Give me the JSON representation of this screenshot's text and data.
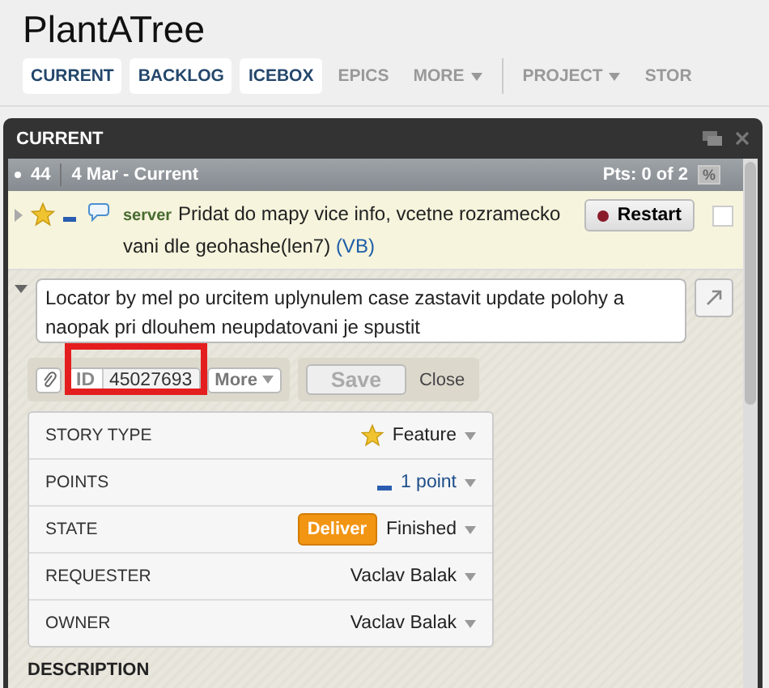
{
  "project": {
    "title": "PlantATree"
  },
  "nav": {
    "panels": [
      {
        "label": "CURRENT",
        "selected": true
      },
      {
        "label": "BACKLOG",
        "selected": true
      },
      {
        "label": "ICEBOX",
        "selected": true
      },
      {
        "label": "EPICS",
        "selected": false
      }
    ],
    "more_menu": {
      "label": "MORE"
    },
    "project_menus": [
      {
        "label": "PROJECT"
      },
      {
        "label": "STOR"
      }
    ]
  },
  "panel": {
    "title": "CURRENT",
    "iteration": {
      "number": "44",
      "dates": "4 Mar - Current",
      "points": "Pts: 0 of 2",
      "percent_button": "%"
    },
    "story": {
      "label": "server",
      "title": "Pridat do mapy vice info, vcetne rozramecko vani dle geohashe(len7)",
      "owner": "(VB)",
      "button": "Restart",
      "selected": false
    },
    "details": {
      "description": "Locator by mel po urcitem uplynulem case zastavit update polohy a naopak pri dlouhem neupdatovani je spustit",
      "id_label": "ID",
      "id": "45027693",
      "highlighted": true,
      "more": "More",
      "save": {
        "label": "Save",
        "disabled": true
      },
      "close": "Close",
      "fields": [
        {
          "kind": "type",
          "label": "STORY TYPE",
          "value": "Feature"
        },
        {
          "kind": "points",
          "label": "POINTS",
          "value": "1 point"
        },
        {
          "kind": "state",
          "label": "STATE",
          "value": "Finished",
          "button": "Deliver"
        },
        {
          "kind": "plain",
          "label": "REQUESTER",
          "value": "Vaclav Balak"
        },
        {
          "kind": "plain",
          "label": "OWNER",
          "value": "Vaclav Balak"
        }
      ],
      "section": "DESCRIPTION"
    }
  }
}
